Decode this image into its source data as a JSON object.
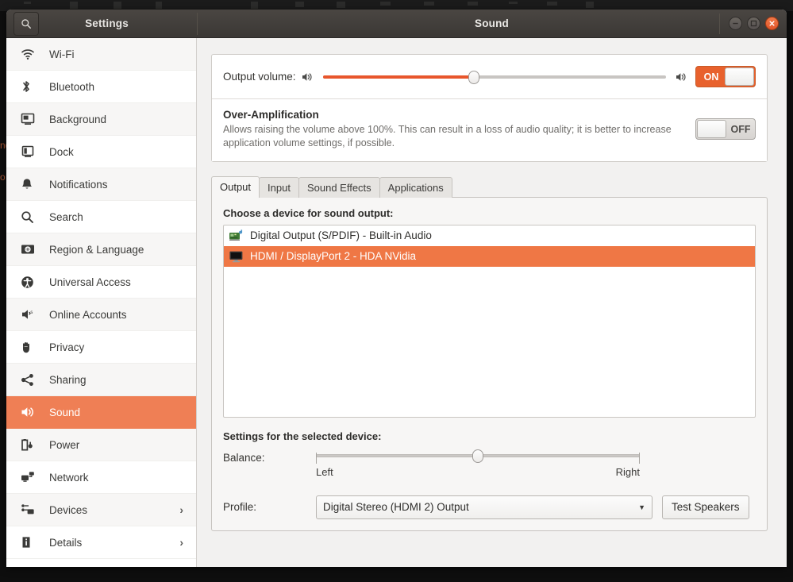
{
  "desktop": {
    "left_hint_1": "nd",
    "left_hint_2": "o"
  },
  "titlebar": {
    "search_icon": "search-icon",
    "settings_title": "Settings",
    "window_title": "Sound",
    "minimize_label": "",
    "maximize_label": "",
    "close_label": ""
  },
  "sidebar": {
    "items": [
      {
        "label": "Wi-Fi",
        "icon": "wifi-icon",
        "chevron": "",
        "selected": false
      },
      {
        "label": "Bluetooth",
        "icon": "bluetooth-icon",
        "chevron": "",
        "selected": false
      },
      {
        "label": "Background",
        "icon": "background-icon",
        "chevron": "",
        "selected": false
      },
      {
        "label": "Dock",
        "icon": "dock-icon",
        "chevron": "",
        "selected": false
      },
      {
        "label": "Notifications",
        "icon": "bell-icon",
        "chevron": "",
        "selected": false
      },
      {
        "label": "Search",
        "icon": "search-icon",
        "chevron": "",
        "selected": false
      },
      {
        "label": "Region & Language",
        "icon": "region-language-icon",
        "chevron": "",
        "selected": false
      },
      {
        "label": "Universal Access",
        "icon": "accessibility-icon",
        "chevron": "",
        "selected": false
      },
      {
        "label": "Online Accounts",
        "icon": "online-accounts-icon",
        "chevron": "",
        "selected": false
      },
      {
        "label": "Privacy",
        "icon": "hand-privacy-icon",
        "chevron": "",
        "selected": false
      },
      {
        "label": "Sharing",
        "icon": "share-icon",
        "chevron": "",
        "selected": false
      },
      {
        "label": "Sound",
        "icon": "speaker-icon",
        "chevron": "",
        "selected": true
      },
      {
        "label": "Power",
        "icon": "battery-power-icon",
        "chevron": "",
        "selected": false
      },
      {
        "label": "Network",
        "icon": "network-icon",
        "chevron": "",
        "selected": false
      },
      {
        "label": "Devices",
        "icon": "devices-icon",
        "chevron": "›",
        "selected": false
      },
      {
        "label": "Details",
        "icon": "info-icon",
        "chevron": "›",
        "selected": false
      }
    ]
  },
  "volume": {
    "label": "Output volume:",
    "low_icon": "speaker-low-icon",
    "high_icon": "speaker-high-icon",
    "slider_percent": 44,
    "mute_toggle": {
      "state_label": "ON",
      "on": true
    }
  },
  "over_amplification": {
    "title": "Over-Amplification",
    "description": "Allows raising the volume above 100%. This can result in a loss of audio quality; it is better to increase application volume settings, if possible.",
    "toggle": {
      "state_label": "OFF",
      "on": false
    }
  },
  "tabs": [
    {
      "label": "Output",
      "active": true
    },
    {
      "label": "Input",
      "active": false
    },
    {
      "label": "Sound Effects",
      "active": false
    },
    {
      "label": "Applications",
      "active": false
    }
  ],
  "output_panel": {
    "choose_device_heading": "Choose a device for sound output:",
    "devices": [
      {
        "label": "Digital Output (S/PDIF) - Built-in Audio",
        "icon": "soundcard-icon",
        "selected": false
      },
      {
        "label": "HDMI / DisplayPort 2 - HDA NVidia",
        "icon": "monitor-icon",
        "selected": true
      }
    ],
    "settings_heading": "Settings for the selected device:",
    "balance": {
      "label": "Balance:",
      "left_label": "Left",
      "right_label": "Right",
      "position_percent": 50
    },
    "profile": {
      "label": "Profile:",
      "value": "Digital Stereo (HDMI 2) Output",
      "arrow": "▼",
      "test_button": "Test Speakers"
    }
  },
  "colors": {
    "accent_orange": "#ef7745",
    "slider_orange": "#e8562c",
    "sidebar_selected": "#ef7f55",
    "window_bg": "#f2f1f0"
  }
}
